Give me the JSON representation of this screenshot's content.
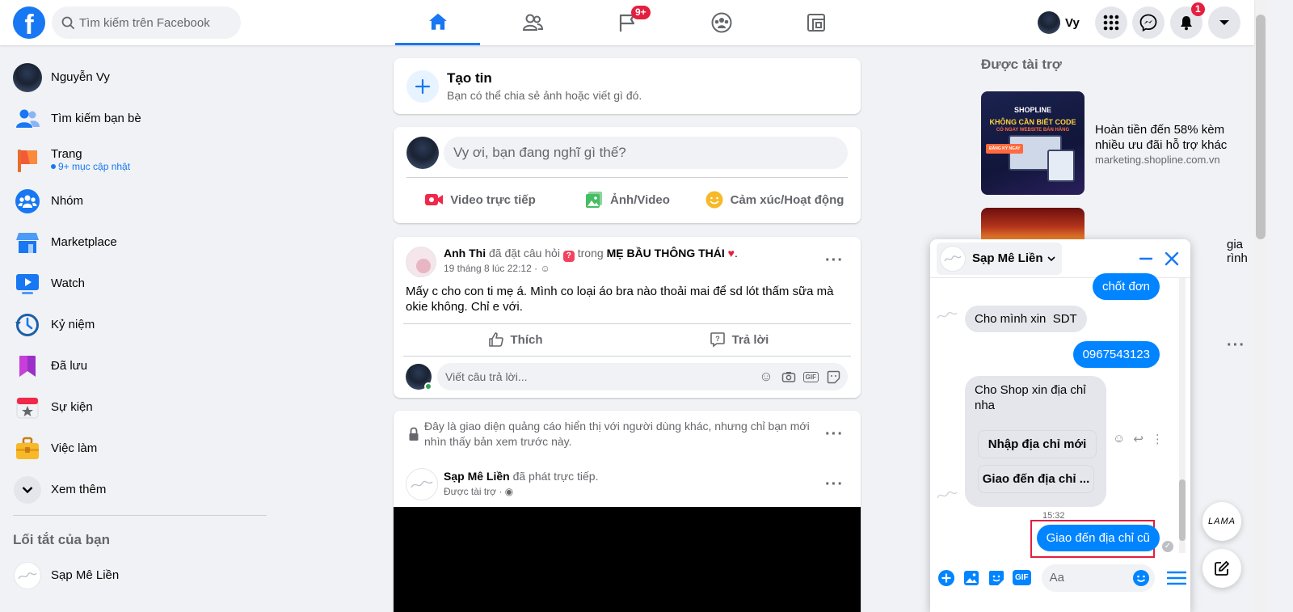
{
  "header": {
    "logo": "f",
    "search_placeholder": "Tìm kiếm trên Facebook",
    "nav": [
      {
        "name": "home-icon",
        "active": true,
        "badge": ""
      },
      {
        "name": "friends-icon",
        "active": false,
        "badge": ""
      },
      {
        "name": "pages-flag-icon",
        "active": false,
        "badge": "9+"
      },
      {
        "name": "groups-icon",
        "active": false,
        "badge": ""
      },
      {
        "name": "gaming-icon",
        "active": false,
        "badge": ""
      }
    ],
    "profile_name": "Vy",
    "notification_badge": "1"
  },
  "sidebar": {
    "items": [
      {
        "label": "Nguyễn Vy",
        "icon": "avatar"
      },
      {
        "label": "Tìm kiếm bạn bè",
        "icon": "friends-icon"
      },
      {
        "label": "Trang",
        "icon": "flag-icon",
        "sub": "9+ mục cập nhật"
      },
      {
        "label": "Nhóm",
        "icon": "groups-icon"
      },
      {
        "label": "Marketplace",
        "icon": "marketplace-icon"
      },
      {
        "label": "Watch",
        "icon": "watch-icon"
      },
      {
        "label": "Kỷ niệm",
        "icon": "memories-icon"
      },
      {
        "label": "Đã lưu",
        "icon": "saved-icon"
      },
      {
        "label": "Sự kiện",
        "icon": "events-icon"
      },
      {
        "label": "Việc làm",
        "icon": "jobs-icon"
      },
      {
        "label": "Xem thêm",
        "icon": "chevron-down-icon"
      }
    ],
    "shortcuts_title": "Lối tắt của bạn",
    "shortcuts": [
      {
        "label": "Sạp Mê Liền"
      }
    ]
  },
  "story": {
    "title": "Tạo tin",
    "subtitle": "Bạn có thể chia sẻ ảnh hoặc viết gì đó."
  },
  "composer": {
    "placeholder": "Vy ơi, bạn đang nghĩ gì thế?",
    "actions": [
      "Video trực tiếp",
      "Ảnh/Video",
      "Cảm xúc/Hoạt động"
    ]
  },
  "post": {
    "author": "Anh Thi",
    "action": "đã đặt câu hỏi",
    "in": "trong",
    "group": "MẸ BẦU THÔNG THÁI",
    "time": "19 tháng 8 lúc 22:12 ·",
    "text": "Mấy c cho con ti mẹ á. Mình co loại áo bra nào thoải mai để sd lót thấm sữa mà okie không. Chỉ e với.",
    "like": "Thích",
    "reply": "Trả lời",
    "comment_placeholder": "Viết câu trả lời..."
  },
  "ad_preview": {
    "notice": "Đây là giao diện quảng cáo hiển thị với người dùng khác, nhưng chỉ bạn mới nhìn thấy bản xem trước này.",
    "page": "Sạp Mê Liền",
    "action": "đã phát trực tiếp.",
    "sponsored": "Được tài trợ ·"
  },
  "right": {
    "sponsored_title": "Được tài trợ",
    "ads": [
      {
        "title": "Hoàn tiền đến 58% kèm nhiều ưu đãi hỗ trợ khác",
        "domain": "marketing.shopline.com.vn",
        "image_brand": "SHOPLINE",
        "image_headline": "KHÔNG CẦN BIẾT CODE",
        "image_sub": "CÓ NGAY WEBSITE BÁN HÀNG",
        "image_cta": "ĐĂNG KÝ NGAY"
      },
      {
        "title": "gia rình",
        "domain": ""
      }
    ]
  },
  "chat": {
    "title": "Sạp Mê Liền",
    "messages": [
      {
        "dir": "out",
        "text": "chốt đơn"
      },
      {
        "dir": "in",
        "text": "Cho mình xin  SDT"
      },
      {
        "dir": "out",
        "text": "0967543123"
      },
      {
        "dir": "in",
        "text": "Cho Shop xin địa chỉ nha"
      }
    ],
    "quick_replies": [
      "Nhập địa chỉ mới",
      "Giao đến địa chỉ ..."
    ],
    "timestamp": "15:32",
    "last_out": "Giao đến địa chỉ cũ",
    "input_placeholder": "Aa",
    "highlight_color": "#e41e3f"
  },
  "floating": {
    "lama": "LAMA"
  }
}
